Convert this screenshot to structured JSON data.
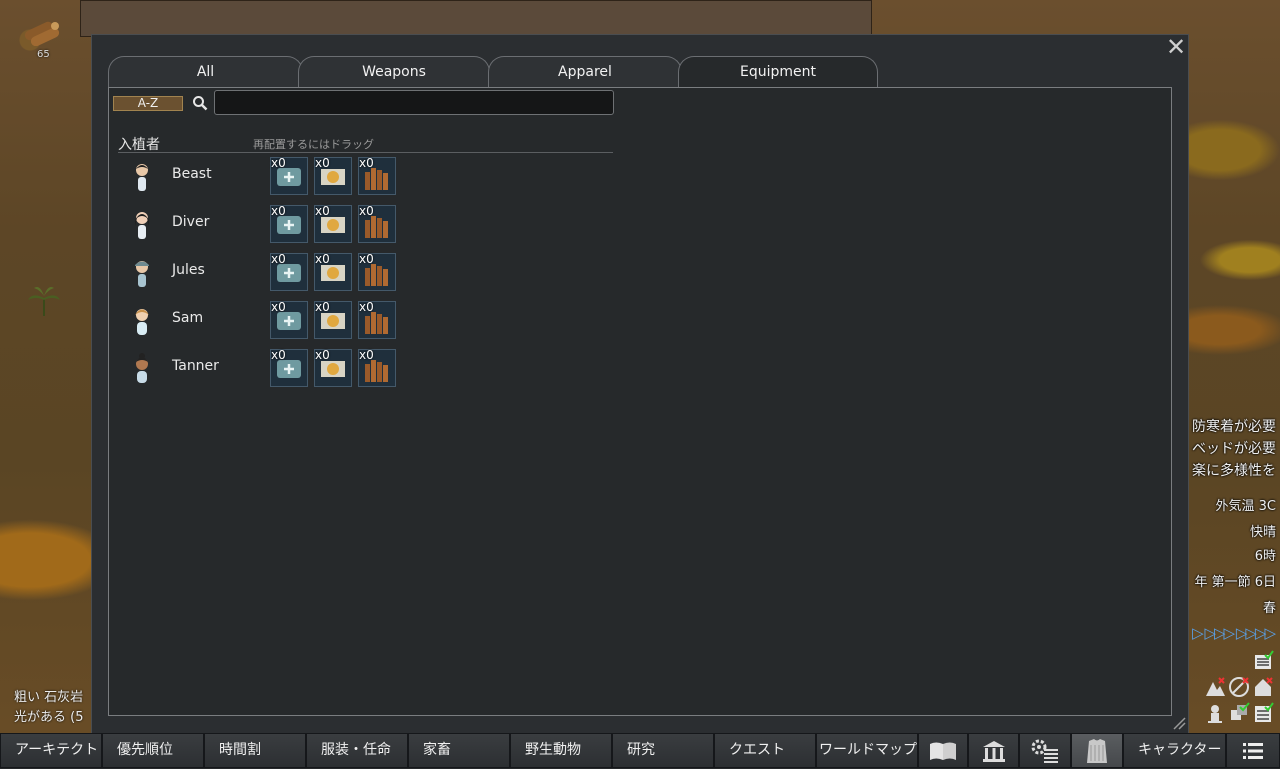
{
  "map": {
    "wood_count": "65",
    "terrain_line1": "粗い 石灰岩",
    "terrain_line2": "光がある (5"
  },
  "hud": {
    "alerts": [
      "防寒着が必要",
      "ベッドが必要",
      "楽に多様性を"
    ],
    "temperature": "外気温 3C",
    "comfort": "快晴",
    "hour": "6時",
    "date": "年 第一節 6日",
    "season": "春",
    "speed_glyphs": "▷ ▷▷▷ ▷▷▷▷"
  },
  "dialog": {
    "close_glyph": "✕",
    "tabs": [
      {
        "label": "All"
      },
      {
        "label": "Weapons"
      },
      {
        "label": "Apparel"
      },
      {
        "label": "Equipment"
      }
    ],
    "active_tab": "Equipment",
    "sort_label": "A-Z",
    "search": {
      "value": "",
      "placeholder": ""
    },
    "column_header": "入植者",
    "drag_hint": "再配置するにはドラッグ",
    "colonists": [
      {
        "name": "Beast",
        "slots": [
          "x0",
          "x0",
          "x0"
        ]
      },
      {
        "name": "Diver",
        "slots": [
          "x0",
          "x0",
          "x0"
        ]
      },
      {
        "name": "Jules",
        "slots": [
          "x0",
          "x0",
          "x0"
        ]
      },
      {
        "name": "Sam",
        "slots": [
          "x0",
          "x0",
          "x0"
        ]
      },
      {
        "name": "Tanner",
        "slots": [
          "x0",
          "x0",
          "x0"
        ]
      }
    ],
    "slot_icons": [
      "medicine-kit-icon",
      "gold-plate-icon",
      "wooden-stakes-icon"
    ]
  },
  "bottom_bar": {
    "items": [
      {
        "label": "アーキテクト"
      },
      {
        "label": "優先順位"
      },
      {
        "label": "時間割"
      },
      {
        "label": "服装・任命"
      },
      {
        "label": "家畜"
      },
      {
        "label": "野生動物"
      },
      {
        "label": "研究"
      },
      {
        "label": "クエスト"
      },
      {
        "label": "ワールドマップ"
      },
      {
        "icon": "book-icon"
      },
      {
        "icon": "faction-building-icon"
      },
      {
        "icon": "gear-list-icon"
      },
      {
        "icon": "loadout-shirt-icon"
      },
      {
        "label": "キャラクター"
      },
      {
        "icon": "menu-list-icon"
      }
    ]
  },
  "colors": {
    "window_bg": "#2b2e31",
    "slot_bg": "#1f2f3c",
    "sort_button": "#6b5130",
    "speed_arrows": "#5aa0e6"
  }
}
